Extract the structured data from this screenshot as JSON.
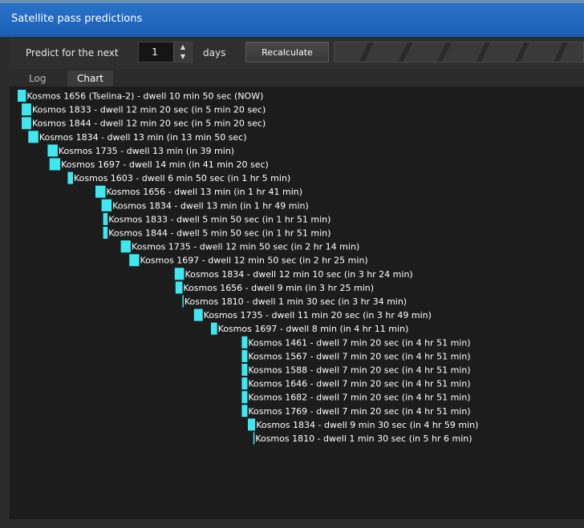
{
  "window": {
    "title": "Satellite pass predictions"
  },
  "toolbar": {
    "predict_label": "Predict for the next",
    "days_value": "1",
    "days_label": "days",
    "recalculate_label": "Recalculate"
  },
  "tabs": [
    {
      "label": "Log",
      "active": false
    },
    {
      "label": "Chart",
      "active": true
    }
  ],
  "colors": {
    "bar": "#3ee8f0",
    "title_bar": "#1f66bd",
    "panel": "#1c1c1c"
  },
  "chart_data": {
    "type": "gantt",
    "x_unit": "minutes from now",
    "passes": [
      {
        "label": "Kosmos 1656 (Tselina-2) - dwell 10 min 50 sec (NOW)",
        "start": 0,
        "dwell": 10.83
      },
      {
        "label": "Kosmos 1833 - dwell 12 min 20 sec (in 5 min 20 sec)",
        "start": 5.33,
        "dwell": 12.33
      },
      {
        "label": "Kosmos 1844 - dwell 12 min 20 sec (in 5 min 20 sec)",
        "start": 5.33,
        "dwell": 12.33
      },
      {
        "label": "Kosmos 1834 - dwell 13 min (in 13 min 50 sec)",
        "start": 13.83,
        "dwell": 13
      },
      {
        "label": "Kosmos 1735 - dwell 13 min (in 39 min)",
        "start": 39,
        "dwell": 13
      },
      {
        "label": "Kosmos 1697 - dwell 14 min (in 41 min 20 sec)",
        "start": 41.33,
        "dwell": 14
      },
      {
        "label": "Kosmos 1603 - dwell 6 min 50 sec (in 1 hr 5 min)",
        "start": 65,
        "dwell": 6.83
      },
      {
        "label": "Kosmos 1656 - dwell 13 min (in 1 hr 41 min)",
        "start": 101,
        "dwell": 13
      },
      {
        "label": "Kosmos 1834 - dwell 13 min (in 1 hr 49 min)",
        "start": 109,
        "dwell": 13
      },
      {
        "label": "Kosmos 1833 - dwell 5 min 50 sec (in 1 hr 51 min)",
        "start": 111,
        "dwell": 5.83
      },
      {
        "label": "Kosmos 1844 - dwell 5 min 50 sec (in 1 hr 51 min)",
        "start": 111,
        "dwell": 5.83
      },
      {
        "label": "Kosmos 1735 - dwell 12 min 50 sec (in 2 hr 14 min)",
        "start": 134,
        "dwell": 12.83
      },
      {
        "label": "Kosmos 1697 - dwell 12 min 50 sec (in 2 hr 25 min)",
        "start": 145,
        "dwell": 12.83
      },
      {
        "label": "Kosmos 1834 - dwell 12 min 10 sec (in 3 hr 24 min)",
        "start": 204,
        "dwell": 12.17
      },
      {
        "label": "Kosmos 1656 - dwell 9 min (in 3 hr 25 min)",
        "start": 205,
        "dwell": 9
      },
      {
        "label": "Kosmos 1810 - dwell 1 min 30 sec (in 3 hr 34 min)",
        "start": 214,
        "dwell": 1.5
      },
      {
        "label": "Kosmos 1735 - dwell 11 min 20 sec (in 3 hr 49 min)",
        "start": 229,
        "dwell": 11.33
      },
      {
        "label": "Kosmos 1697 - dwell 8 min (in 4 hr 11 min)",
        "start": 251,
        "dwell": 8
      },
      {
        "label": "Kosmos 1461 - dwell 7 min 20 sec (in 4 hr 51 min)",
        "start": 291,
        "dwell": 7.33
      },
      {
        "label": "Kosmos 1567 - dwell 7 min 20 sec (in 4 hr 51 min)",
        "start": 291,
        "dwell": 7.33
      },
      {
        "label": "Kosmos 1588 - dwell 7 min 20 sec (in 4 hr 51 min)",
        "start": 291,
        "dwell": 7.33
      },
      {
        "label": "Kosmos 1646 - dwell 7 min 20 sec (in 4 hr 51 min)",
        "start": 291,
        "dwell": 7.33
      },
      {
        "label": "Kosmos 1682 - dwell 7 min 20 sec (in 4 hr 51 min)",
        "start": 291,
        "dwell": 7.33
      },
      {
        "label": "Kosmos 1769 - dwell 7 min 20 sec (in 4 hr 51 min)",
        "start": 291,
        "dwell": 7.33
      },
      {
        "label": "Kosmos 1834 - dwell 9 min 30 sec (in 4 hr 59 min)",
        "start": 299,
        "dwell": 9.5
      },
      {
        "label": "Kosmos 1810 - dwell 1 min 30 sec (in 5 hr 6 min)",
        "start": 306,
        "dwell": 1.5
      }
    ]
  }
}
